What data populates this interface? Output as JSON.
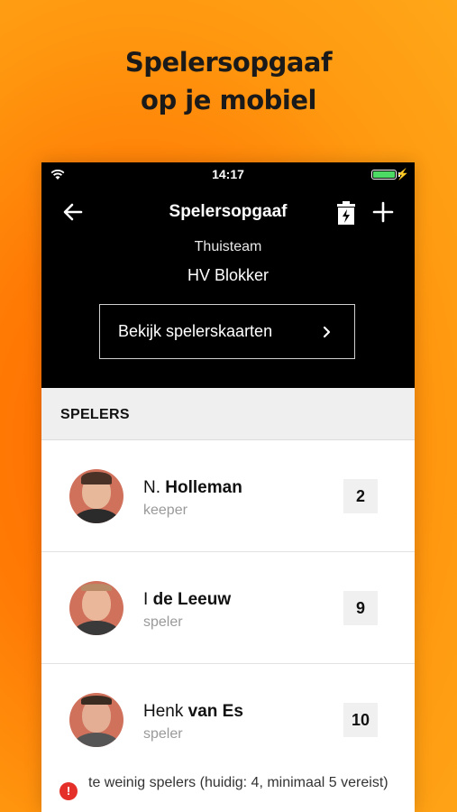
{
  "headline": {
    "line1": "Spelersopgaaf",
    "line2": "op je mobiel"
  },
  "status_bar": {
    "time": "14:17",
    "battery_color": "#4cd964"
  },
  "nav": {
    "title": "Spelersopgaaf",
    "back_icon": "arrow-left-icon",
    "trash_icon": "trash-icon",
    "add_icon": "plus-icon"
  },
  "team": {
    "label": "Thuisteam",
    "name": "HV Blokker"
  },
  "cards_button": {
    "label": "Bekijk spelerskaarten",
    "icon": "chevron-right-icon"
  },
  "section": {
    "label": "SPELERS"
  },
  "players": [
    {
      "first": "N. ",
      "last": "Holleman",
      "role": "keeper",
      "number": "2"
    },
    {
      "first": "I ",
      "last": "de Leeuw",
      "role": "speler",
      "number": "9"
    },
    {
      "first": "Henk ",
      "last": "van Es",
      "role": "speler",
      "number": "10"
    }
  ],
  "warning": {
    "icon": "!",
    "text": "te weinig spelers (huidig: 4, minimaal 5 vereist)",
    "color": "#e5302a"
  },
  "colors": {
    "background_accent": "#ff7a05",
    "header": "#000000"
  }
}
